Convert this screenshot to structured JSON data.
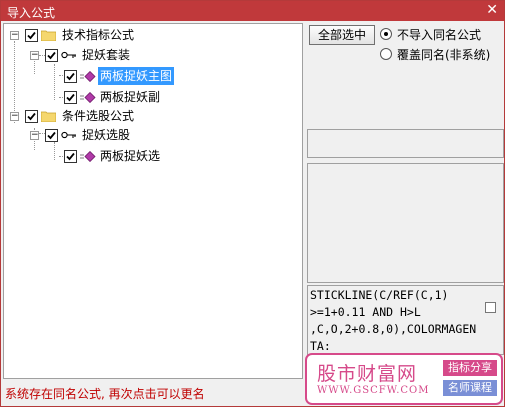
{
  "window": {
    "title": "导入公式",
    "close_glyph": "✕"
  },
  "tree": {
    "items": [
      {
        "label": "技术指标公式"
      },
      {
        "label": "捉妖套装"
      },
      {
        "label": "两板捉妖主图"
      },
      {
        "label": "两板捉妖副"
      },
      {
        "label": "条件选股公式"
      },
      {
        "label": "捉妖选股"
      },
      {
        "label": "两板捉妖选"
      }
    ]
  },
  "right": {
    "select_all_label": "全部选中",
    "options": [
      {
        "label": "不导入同名公式",
        "selected": true
      },
      {
        "label": "覆盖同名(非系统)",
        "selected": false
      }
    ],
    "code_lines": [
      "STICKLINE(C/REF(C,1)",
      ">=1+0.11 AND H>L",
      ",C,O,2+0.8,0),COLORMAGEN",
      "TA:"
    ]
  },
  "status_text": "系统存在同名公式, 再次点击可以更名",
  "watermark": {
    "brand": "股市财富网",
    "url": "WWW.GSCFW.COM",
    "tag1": "指标分享",
    "tag2": "名师课程"
  },
  "colors": {
    "title_bar": "#c0393b",
    "selection": "#3399ff",
    "status": "#c00000",
    "watermark": "#d64a8a"
  }
}
